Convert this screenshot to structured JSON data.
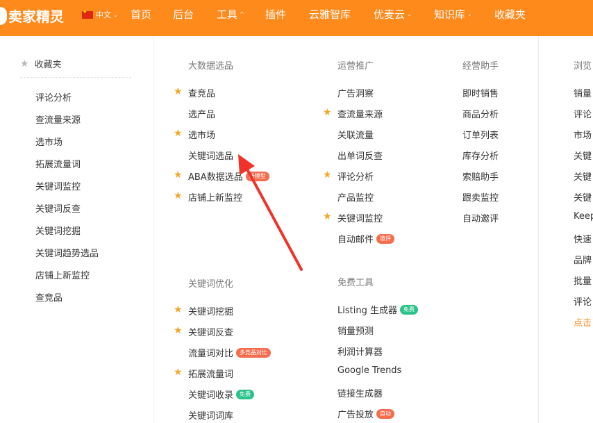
{
  "header": {
    "brand": "卖家精灵",
    "language": "中文",
    "nav": [
      {
        "label": "首页",
        "caret": ""
      },
      {
        "label": "后台",
        "caret": ""
      },
      {
        "label": "工具",
        "caret": "^"
      },
      {
        "label": "插件",
        "caret": ""
      },
      {
        "label": "云雅智库",
        "caret": ""
      },
      {
        "label": "优麦云",
        "caret": "⌄"
      },
      {
        "label": "知识库",
        "caret": "⌄"
      },
      {
        "label": "收藏夹",
        "caret": ""
      }
    ]
  },
  "favorites": {
    "title": "收藏夹",
    "items": [
      "评论分析",
      "查流量来源",
      "选市场",
      "拓展流量词",
      "关键词监控",
      "关键词反查",
      "关键词挖掘",
      "关键词趋势选品",
      "店铺上新监控",
      "查竞品"
    ]
  },
  "sections": {
    "big_data": {
      "title": "大数据选品",
      "items": [
        {
          "label": "查竞品",
          "starred": true,
          "badge": ""
        },
        {
          "label": "选产品",
          "starred": false,
          "badge": ""
        },
        {
          "label": "选市场",
          "starred": true,
          "badge": ""
        },
        {
          "label": "关键词选品",
          "starred": false,
          "badge": ""
        },
        {
          "label": "ABA数据选品",
          "starred": true,
          "badge": "新模型"
        },
        {
          "label": "店铺上新监控",
          "starred": true,
          "badge": ""
        }
      ]
    },
    "operations": {
      "title": "运营推广",
      "items": [
        {
          "label": "广告洞察",
          "starred": false,
          "badge": ""
        },
        {
          "label": "查流量来源",
          "starred": true,
          "badge": ""
        },
        {
          "label": "关联流量",
          "starred": false,
          "badge": ""
        },
        {
          "label": "出单词反查",
          "starred": false,
          "badge": ""
        },
        {
          "label": "评论分析",
          "starred": true,
          "badge": ""
        },
        {
          "label": "产品监控",
          "starred": false,
          "badge": ""
        },
        {
          "label": "关键词监控",
          "starred": true,
          "badge": ""
        },
        {
          "label": "自动邮件",
          "starred": false,
          "badge": "邀评"
        }
      ]
    },
    "assistant": {
      "title": "经营助手",
      "items": [
        {
          "label": "即时销售"
        },
        {
          "label": "商品分析"
        },
        {
          "label": "订单列表"
        },
        {
          "label": "库存分析"
        },
        {
          "label": "索赔助手"
        },
        {
          "label": "跟卖监控"
        },
        {
          "label": "自动邀评"
        }
      ]
    },
    "keyword_opt": {
      "title": "关键词优化",
      "items": [
        {
          "label": "关键词挖掘",
          "starred": true,
          "badge": ""
        },
        {
          "label": "关键词反查",
          "starred": true,
          "badge": ""
        },
        {
          "label": "流量词对比",
          "starred": false,
          "badge": "多竞品对比"
        },
        {
          "label": "拓展流量词",
          "starred": true,
          "badge": ""
        },
        {
          "label": "关键词收录",
          "starred": false,
          "badge": "免费"
        },
        {
          "label": "关键词词库",
          "starred": false,
          "badge": ""
        }
      ]
    },
    "free_tools": {
      "title": "免费工具",
      "items": [
        {
          "label": "Listing 生成器",
          "badge": "免费"
        },
        {
          "label": "销量预测",
          "badge": ""
        },
        {
          "label": "利润计算器",
          "badge": ""
        },
        {
          "label": "Google Trends",
          "badge": ""
        },
        {
          "label": "链接生成器",
          "badge": ""
        },
        {
          "label": "广告投放",
          "badge": "自动"
        }
      ]
    },
    "plugin_cutoff": {
      "title": "浏览",
      "items": [
        "销量",
        "评论",
        "市场",
        "关键",
        "关键",
        "关键",
        "Keep",
        "快速",
        "品牌",
        "批量",
        "评论",
        "点击"
      ]
    }
  },
  "colors": {
    "accent": "#ff8a1c",
    "star": "#f5a623",
    "badge_red": "#f56d4f",
    "badge_green": "#2bc28b",
    "annotation_arrow": "#f0322a"
  }
}
